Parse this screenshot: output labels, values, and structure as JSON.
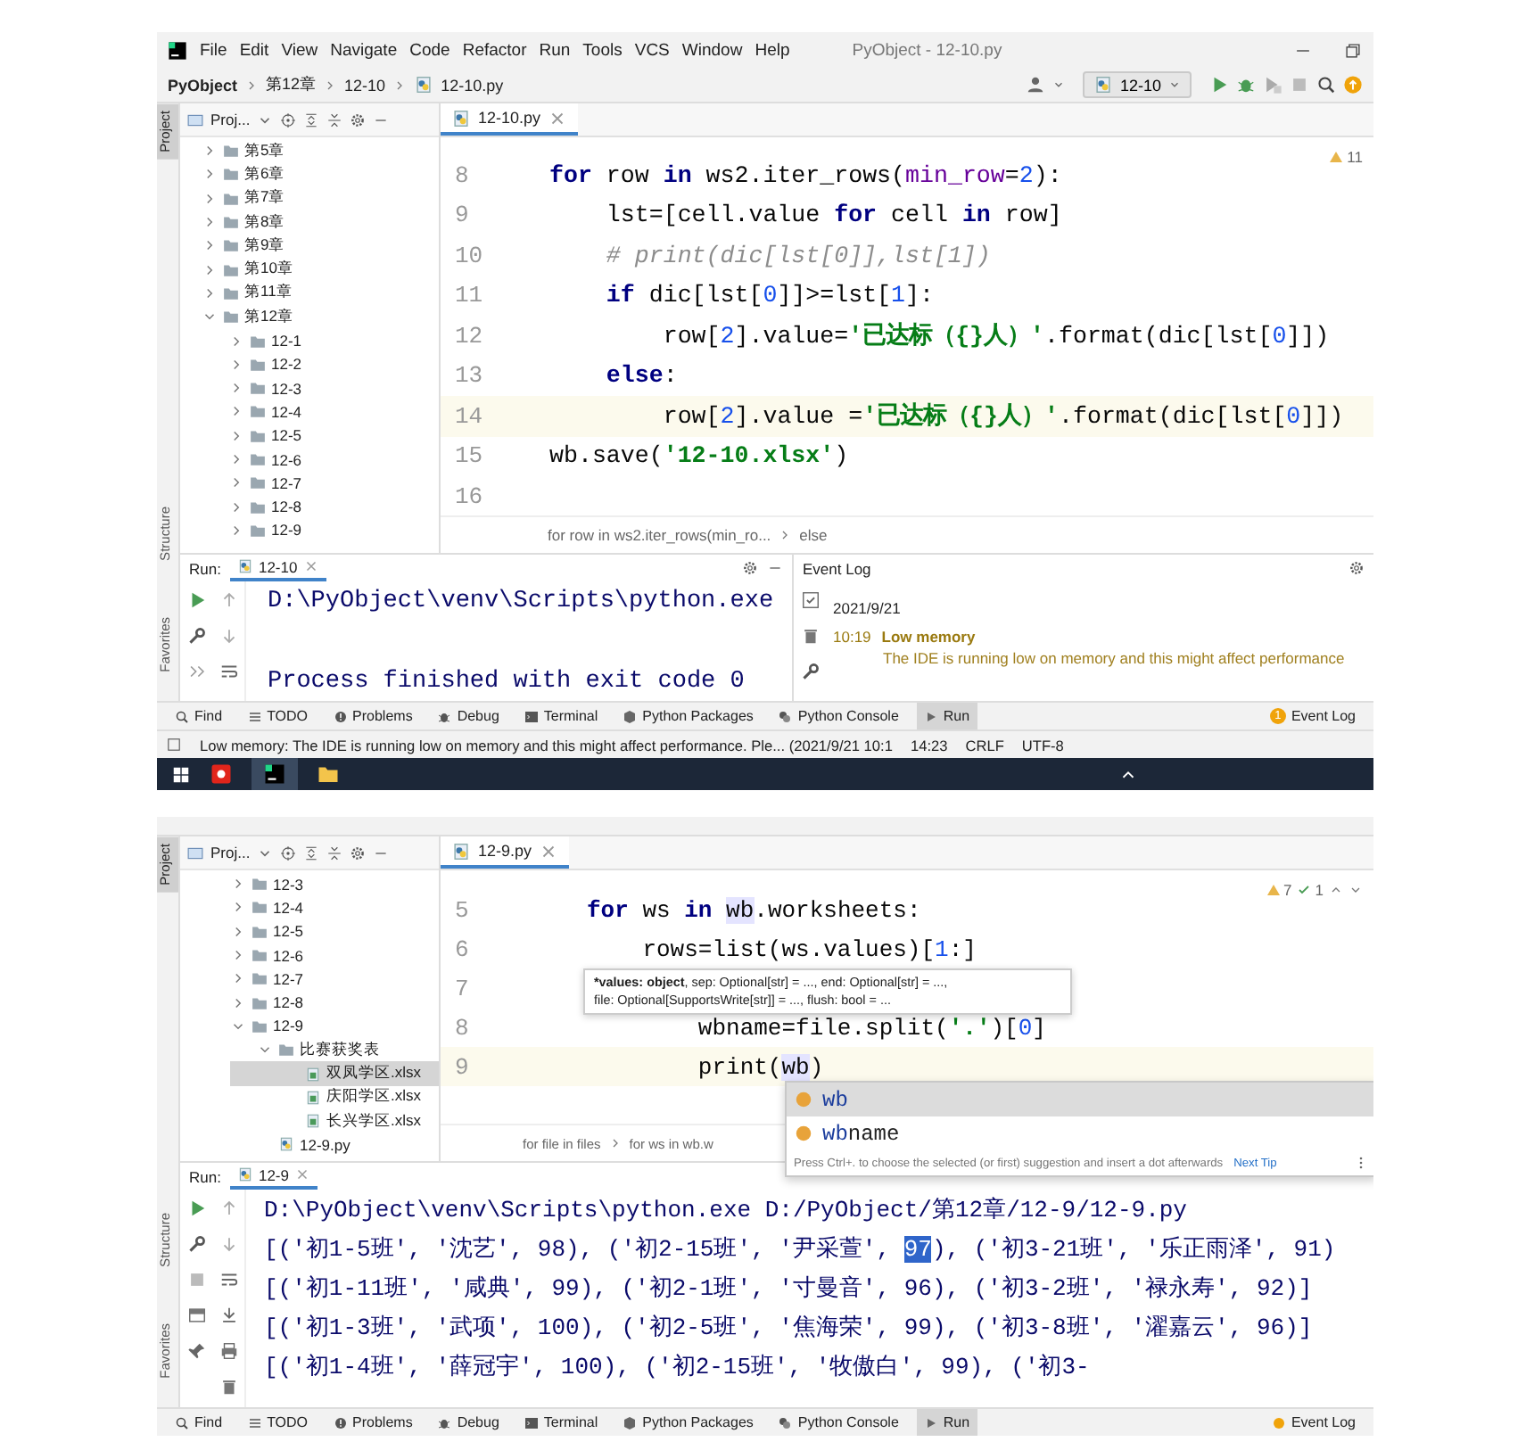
{
  "screens": [
    {
      "menu_bar": {
        "items": [
          "File",
          "Edit",
          "View",
          "Navigate",
          "Code",
          "Refactor",
          "Run",
          "Tools",
          "VCS",
          "Window",
          "Help"
        ],
        "title": "PyObject - 12-10.py"
      },
      "nav_bar": {
        "breadcrumb": [
          "PyObject",
          "第12章",
          "12-10",
          "12-10.py"
        ],
        "run_config": "12-10"
      },
      "side_tabs": [
        {
          "label": "Project",
          "selected": true
        },
        {
          "label": "Structure",
          "selected": false
        },
        {
          "label": "Favorites",
          "selected": false
        }
      ],
      "project_panel": {
        "title": "Proj...",
        "tree": [
          {
            "label": "第5章",
            "kind": "folder",
            "expanded": false,
            "selected": false
          },
          {
            "label": "第6章",
            "kind": "folder",
            "expanded": false,
            "selected": false
          },
          {
            "label": "第7章",
            "kind": "folder",
            "expanded": false,
            "selected": false
          },
          {
            "label": "第8章",
            "kind": "folder",
            "expanded": false,
            "selected": false
          },
          {
            "label": "第9章",
            "kind": "folder",
            "expanded": false,
            "selected": false
          },
          {
            "label": "第10章",
            "kind": "folder",
            "expanded": false,
            "selected": false
          },
          {
            "label": "第11章",
            "kind": "folder",
            "expanded": false,
            "selected": false
          },
          {
            "label": "第12章",
            "kind": "folder",
            "expanded": true,
            "selected": false,
            "children": [
              {
                "label": "12-1",
                "kind": "folder",
                "expanded": false,
                "selected": false
              },
              {
                "label": "12-2",
                "kind": "folder",
                "expanded": false,
                "selected": false
              },
              {
                "label": "12-3",
                "kind": "folder",
                "expanded": false,
                "selected": false
              },
              {
                "label": "12-4",
                "kind": "folder",
                "expanded": false,
                "selected": false
              },
              {
                "label": "12-5",
                "kind": "folder",
                "expanded": false,
                "selected": false
              },
              {
                "label": "12-6",
                "kind": "folder",
                "expanded": false,
                "selected": false
              },
              {
                "label": "12-7",
                "kind": "folder",
                "expanded": false,
                "selected": false
              },
              {
                "label": "12-8",
                "kind": "folder",
                "expanded": false,
                "selected": false
              },
              {
                "label": "12-9",
                "kind": "folder",
                "expanded": false,
                "selected": false
              }
            ]
          }
        ]
      },
      "editor": {
        "tab": "12-10.py",
        "inspections": [
          {
            "kind": "warning",
            "count": "11"
          }
        ],
        "lines": [
          {
            "number": "8",
            "current": false,
            "tokens": [
              {
                "kind": "kw",
                "text": "for"
              },
              {
                "kind": "plain",
                "text": " row "
              },
              {
                "kind": "kw",
                "text": "in"
              },
              {
                "kind": "plain",
                "text": " ws2.iter_rows("
              },
              {
                "kind": "param",
                "text": "min_row"
              },
              {
                "kind": "plain",
                "text": "="
              },
              {
                "kind": "num",
                "text": "2"
              },
              {
                "kind": "plain",
                "text": "):"
              }
            ]
          },
          {
            "number": "9",
            "current": false,
            "tokens": [
              {
                "kind": "plain",
                "text": "    lst=[cell.value "
              },
              {
                "kind": "kw",
                "text": "for"
              },
              {
                "kind": "plain",
                "text": " cell "
              },
              {
                "kind": "kw",
                "text": "in"
              },
              {
                "kind": "plain",
                "text": " row]"
              }
            ]
          },
          {
            "number": "10",
            "current": false,
            "tokens": [
              {
                "kind": "com",
                "text": "    # print(dic[lst[0]],lst[1])"
              }
            ]
          },
          {
            "number": "11",
            "current": false,
            "tokens": [
              {
                "kind": "kw",
                "text": "    if"
              },
              {
                "kind": "plain",
                "text": " dic[lst["
              },
              {
                "kind": "num",
                "text": "0"
              },
              {
                "kind": "plain",
                "text": "]]>=lst["
              },
              {
                "kind": "num",
                "text": "1"
              },
              {
                "kind": "plain",
                "text": "]:"
              }
            ]
          },
          {
            "number": "12",
            "current": false,
            "tokens": [
              {
                "kind": "plain",
                "text": "        row["
              },
              {
                "kind": "num",
                "text": "2"
              },
              {
                "kind": "plain",
                "text": "].value="
              },
              {
                "kind": "str",
                "text": "'已达标（{}人）'"
              },
              {
                "kind": "plain",
                "text": ".format(dic[lst["
              },
              {
                "kind": "num",
                "text": "0"
              },
              {
                "kind": "plain",
                "text": "]])"
              }
            ]
          },
          {
            "number": "13",
            "current": false,
            "tokens": [
              {
                "kind": "kw",
                "text": "    else"
              },
              {
                "kind": "plain",
                "text": ":"
              }
            ]
          },
          {
            "number": "14",
            "current": true,
            "tokens": [
              {
                "kind": "plain",
                "text": "        row["
              },
              {
                "kind": "num",
                "text": "2"
              },
              {
                "kind": "plain",
                "text": "].value ="
              },
              {
                "kind": "str",
                "text": "'已达标（{}人）'"
              },
              {
                "kind": "plain",
                "text": ".format(dic[lst["
              },
              {
                "kind": "num",
                "text": "0"
              },
              {
                "kind": "plain",
                "text": "]])"
              }
            ]
          },
          {
            "number": "15",
            "current": false,
            "tokens": [
              {
                "kind": "plain",
                "text": "wb.save("
              },
              {
                "kind": "str",
                "text": "'12-10.xlsx'"
              },
              {
                "kind": "plain",
                "text": ")"
              }
            ]
          },
          {
            "number": "16",
            "current": false
          }
        ],
        "breadcrumb": [
          "for row in ws2.iter_rows(min_ro...",
          "else"
        ]
      },
      "run_panel": {
        "label": "Run:",
        "tab": "12-10",
        "lines": [
          {
            "segments": [
              {
                "text": "D:\\PyObject\\venv\\Scripts\\python.exe",
                "selected": false
              }
            ]
          },
          {
            "segments": [
              {
                "text": "Process finished with exit code 0",
                "selected": false
              }
            ]
          }
        ]
      },
      "event_log": {
        "title": "Event Log",
        "date": "2021/9/21",
        "entries": [
          {
            "time": "10:19",
            "title": "Low memory",
            "message": "The IDE is running low on memory and this might affect performance"
          }
        ]
      },
      "tool_tabs": [
        {
          "label": "Find",
          "kind": "search",
          "selected": false
        },
        {
          "label": "TODO",
          "kind": "list",
          "selected": false
        },
        {
          "label": "Problems",
          "kind": "problems",
          "selected": false
        },
        {
          "label": "Debug",
          "kind": "bug",
          "selected": false
        },
        {
          "label": "Terminal",
          "kind": "terminal",
          "selected": false
        },
        {
          "label": "Python Packages",
          "kind": "packages",
          "selected": false
        },
        {
          "label": "Python Console",
          "kind": "console",
          "selected": false
        },
        {
          "label": "Run",
          "kind": "run",
          "selected": true
        },
        {
          "label": "Event Log",
          "kind": "event",
          "selected": false,
          "badge": "1"
        }
      ],
      "status_bar": {
        "message": "Low memory: The IDE is running low on memory and this might affect performance. Ple... (2021/9/21 10:1",
        "items": [
          "14:23",
          "CRLF",
          "UTF-8"
        ]
      },
      "taskbar": {
        "apps": [
          {
            "kind": "office",
            "selected": false
          },
          {
            "kind": "ide",
            "selected": true
          },
          {
            "kind": "explorer",
            "selected": false
          }
        ]
      }
    },
    {
      "side_tabs": [
        {
          "label": "Project",
          "selected": true
        },
        {
          "label": "Structure",
          "selected": false
        },
        {
          "label": "Favorites",
          "selected": false
        }
      ],
      "project_panel": {
        "title": "Proj...",
        "tree": [
          {
            "label": "12-3",
            "kind": "folder",
            "expanded": false,
            "selected": false
          },
          {
            "label": "12-4",
            "kind": "folder",
            "expanded": false,
            "selected": false
          },
          {
            "label": "12-5",
            "kind": "folder",
            "expanded": false,
            "selected": false
          },
          {
            "label": "12-6",
            "kind": "folder",
            "expanded": false,
            "selected": false
          },
          {
            "label": "12-7",
            "kind": "folder",
            "expanded": false,
            "selected": false
          },
          {
            "label": "12-8",
            "kind": "folder",
            "expanded": false,
            "selected": false
          },
          {
            "label": "12-9",
            "kind": "folder",
            "expanded": true,
            "selected": false,
            "children": [
              {
                "label": "比赛获奖表",
                "kind": "folder",
                "expanded": true,
                "selected": false,
                "children": [
                  {
                    "label": "双凤学区.xlsx",
                    "kind": "xlsx",
                    "selected": true
                  },
                  {
                    "label": "庆阳学区.xlsx",
                    "kind": "xlsx",
                    "selected": false
                  },
                  {
                    "label": "长兴学区.xlsx",
                    "kind": "xlsx",
                    "selected": false
                  }
                ]
              },
              {
                "label": "12-9.py",
                "kind": "py",
                "selected": false
              }
            ]
          }
        ]
      },
      "editor": {
        "tab": "12-9.py",
        "inspections": [
          {
            "kind": "warning",
            "count": "7"
          },
          {
            "kind": "ok",
            "count": "1"
          }
        ],
        "lines": [
          {
            "number": "5",
            "current": false,
            "tokens": [
              {
                "kind": "kw",
                "text": "for"
              },
              {
                "kind": "plain",
                "text": " ws "
              },
              {
                "kind": "kw",
                "text": "in "
              },
              {
                "kind": "ref",
                "text": "wb"
              },
              {
                "kind": "plain",
                "text": ".worksheets:"
              }
            ]
          },
          {
            "number": "6",
            "current": false,
            "tokens": [
              {
                "kind": "plain",
                "text": "    rows=list(ws.values)["
              },
              {
                "kind": "num",
                "text": "1"
              },
              {
                "kind": "plain",
                "text": ":]"
              }
            ]
          },
          {
            "number": "7",
            "current": false
          },
          {
            "number": "8",
            "current": false,
            "tokens": [
              {
                "kind": "plain",
                "text": "        wbname=file.split("
              },
              {
                "kind": "str",
                "text": "'.'"
              },
              {
                "kind": "plain",
                "text": ")["
              },
              {
                "kind": "num",
                "text": "0"
              },
              {
                "kind": "plain",
                "text": "]"
              }
            ]
          },
          {
            "number": "9",
            "current": true,
            "tokens": [
              {
                "kind": "plain",
                "text": "        print("
              },
              {
                "kind": "ref",
                "text": "wb"
              },
              {
                "kind": "plain",
                "text": ")"
              }
            ]
          }
        ],
        "breadcrumb": [
          "for file in files",
          "for ws in wb.w"
        ],
        "tooltip": {
          "lines": [
            [
              {
                "text": "*values: object",
                "bold": true
              },
              {
                "text": ", sep: Optional[str] = ..., end: Optional[str] = ...,",
                "bold": false
              }
            ],
            [
              {
                "text": "file: Optional[SupportsWrite[str]] = ..., flush: bool = ...",
                "bold": false
              }
            ]
          ]
        },
        "completion": {
          "items": [
            {
              "match": "wb",
              "selected": true
            },
            {
              "match": "wb",
              "rest": "name",
              "selected": false
            }
          ],
          "hint": "Press Ctrl+. to choose the selected (or first) suggestion and insert a dot afterwards",
          "link": "Next Tip"
        }
      },
      "run_panel": {
        "label": "Run:",
        "tab": "12-9",
        "lines": [
          {
            "segments": [
              {
                "text": "D:\\PyObject\\venv\\Scripts\\python.exe D:/PyObject/第12章/12-9/12-9.py",
                "selected": false
              }
            ]
          },
          {
            "segments": [
              {
                "text": "[('初1-5班', '沈艺', 98), ('初2-15班', '尹采萱', ",
                "selected": false
              },
              {
                "text": "97",
                "selected": true
              },
              {
                "text": "), ('初3-21班', '乐正雨泽', 91)",
                "selected": false
              }
            ]
          },
          {
            "segments": [
              {
                "text": "[('初1-11班', '咸典', 99), ('初2-1班', '寸曼音', 96), ('初3-2班', '禄永寿', 92)]",
                "selected": false
              }
            ]
          },
          {
            "segments": [
              {
                "text": "[('初1-3班', '武项', 100), ('初2-5班', '焦海荣', 99), ('初3-8班', '濯嘉云', 96)]",
                "selected": false
              }
            ]
          },
          {
            "segments": [
              {
                "text": "[('初1-4班', '薛冠宇', 100), ('初2-15班', '牧傲白', 99), ('初3-",
                "selected": false
              }
            ]
          }
        ]
      },
      "tool_tabs": [
        {
          "label": "Find",
          "kind": "search",
          "selected": false
        },
        {
          "label": "TODO",
          "kind": "list",
          "selected": false
        },
        {
          "label": "Problems",
          "kind": "problems",
          "selected": false
        },
        {
          "label": "Debug",
          "kind": "bug",
          "selected": false
        },
        {
          "label": "Terminal",
          "kind": "terminal",
          "selected": false
        },
        {
          "label": "Python Packages",
          "kind": "packages",
          "selected": false
        },
        {
          "label": "Python Console",
          "kind": "console",
          "selected": false
        },
        {
          "label": "Run",
          "kind": "run",
          "selected": true
        },
        {
          "label": "Event Log",
          "kind": "event",
          "selected": false,
          "alert": true
        }
      ]
    }
  ]
}
